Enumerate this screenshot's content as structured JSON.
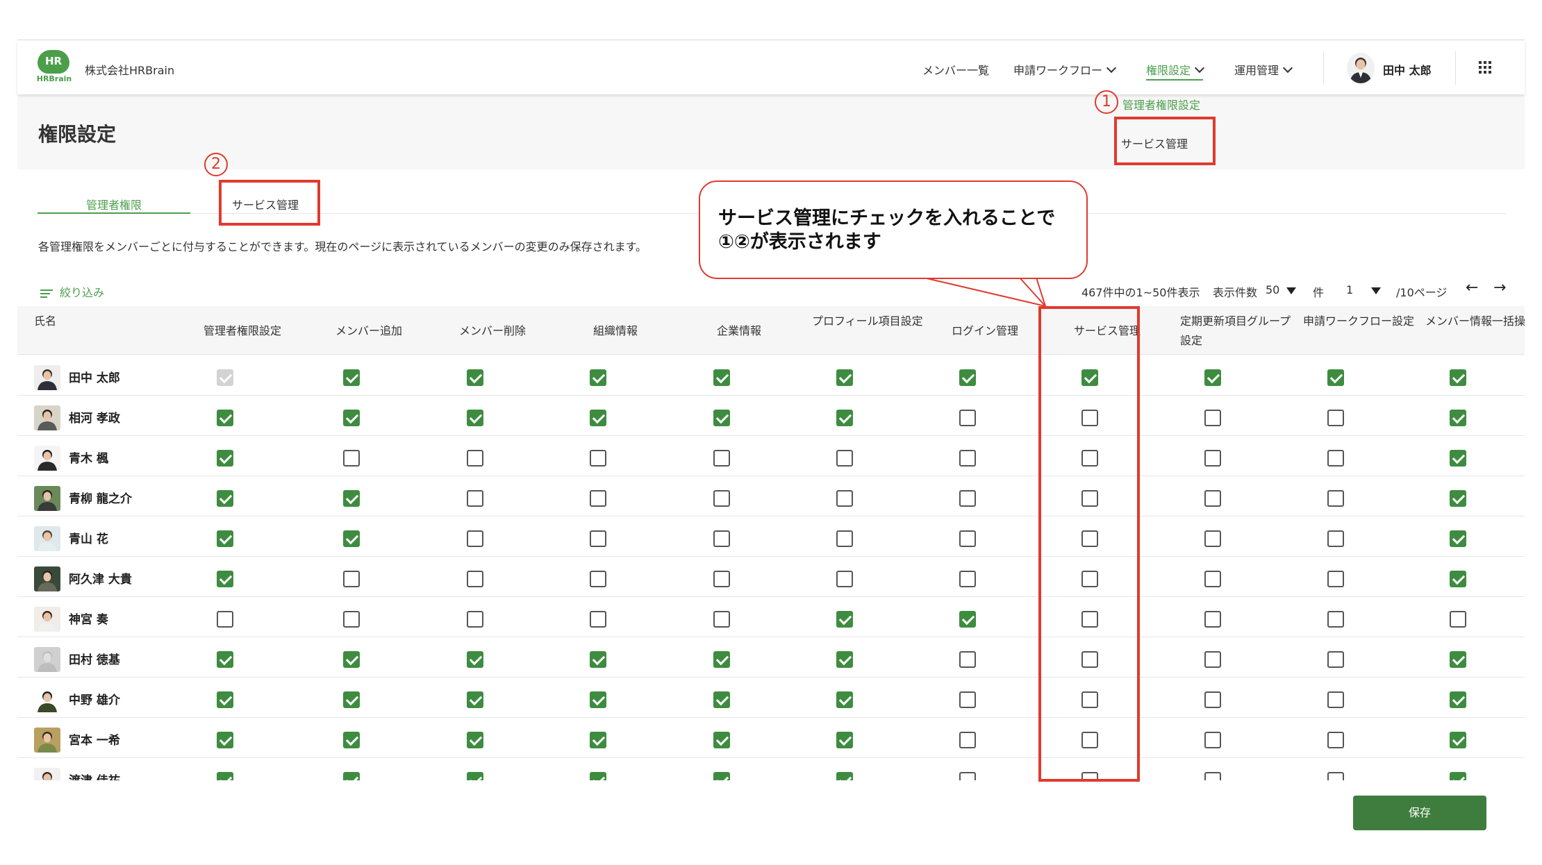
{
  "header": {
    "logo_text": "HR",
    "logo_sub": "HRBrain",
    "company": "株式会社HRBrain",
    "nav": {
      "members": "メンバー一覧",
      "workflow": "申請ワークフロー",
      "permissions": "権限設定",
      "operations": "運用管理"
    },
    "user_name": "田中 太郎"
  },
  "dropdown": {
    "admin_permission": "管理者権限設定",
    "service_management": "サービス管理"
  },
  "page_title": "権限設定",
  "tabs": {
    "admin": "管理者権限",
    "service": "サービス管理"
  },
  "description": "各管理権限をメンバーごとに付与することができます。現在のページに表示されているメンバーの変更のみ保存されます。",
  "filter_label": "絞り込み",
  "pager": {
    "summary": "467件中の1~50件表示",
    "per_page_label": "表示件数",
    "per_page_value": "50",
    "per_page_unit": "件",
    "page_value": "1",
    "page_total": "/10ページ",
    "prev": "←",
    "next": "→"
  },
  "callout": {
    "line1": "サービス管理にチェックを入れることで",
    "line2": "①②が表示されます"
  },
  "markers": {
    "one": "1",
    "two": "2"
  },
  "table": {
    "name_header": "氏名",
    "columns": [
      "管理者権限設定",
      "メンバー追加",
      "メンバー削除",
      "組織情報",
      "企業情報",
      "プロフィール項目設定",
      "ログイン管理",
      "サービス管理",
      "定期更新項目グループ設定",
      "申請ワークフロー設定",
      "メンバー情報一括操作"
    ],
    "rows": [
      {
        "name": "田中 太郎",
        "checks": [
          2,
          1,
          1,
          1,
          1,
          1,
          1,
          1,
          1,
          1,
          1
        ]
      },
      {
        "name": "相河 孝政",
        "checks": [
          1,
          1,
          1,
          1,
          1,
          1,
          0,
          0,
          0,
          0,
          1
        ]
      },
      {
        "name": "青木 楓",
        "checks": [
          1,
          0,
          0,
          0,
          0,
          0,
          0,
          0,
          0,
          0,
          1
        ]
      },
      {
        "name": "青柳 龍之介",
        "checks": [
          1,
          1,
          0,
          0,
          0,
          0,
          0,
          0,
          0,
          0,
          1
        ]
      },
      {
        "name": "青山 花",
        "checks": [
          1,
          1,
          0,
          0,
          0,
          0,
          0,
          0,
          0,
          0,
          1
        ]
      },
      {
        "name": "阿久津 大貴",
        "checks": [
          1,
          0,
          0,
          0,
          0,
          0,
          0,
          0,
          0,
          0,
          1
        ]
      },
      {
        "name": "神宮 奏",
        "checks": [
          0,
          0,
          0,
          0,
          0,
          1,
          1,
          0,
          0,
          0,
          0
        ]
      },
      {
        "name": "田村 徳基",
        "checks": [
          1,
          1,
          1,
          1,
          1,
          1,
          0,
          0,
          0,
          0,
          1
        ]
      },
      {
        "name": "中野 雄介",
        "checks": [
          1,
          1,
          1,
          1,
          1,
          1,
          0,
          0,
          0,
          0,
          1
        ]
      },
      {
        "name": "宮本 一希",
        "checks": [
          1,
          1,
          1,
          1,
          1,
          1,
          0,
          0,
          0,
          0,
          1
        ]
      },
      {
        "name": "渡津 佳祐",
        "checks": [
          1,
          1,
          1,
          1,
          1,
          1,
          0,
          0,
          0,
          0,
          1
        ]
      }
    ]
  },
  "save_label": "保存",
  "colors": {
    "brand_green": "#4c9e4b",
    "check_green": "#3e8c40",
    "annotation_red": "#e03a2e"
  }
}
